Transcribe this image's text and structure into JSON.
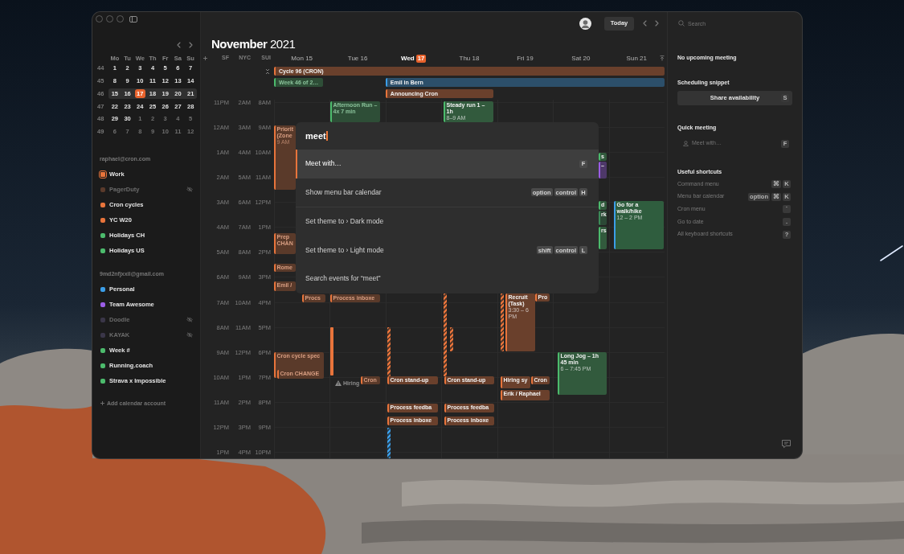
{
  "sidebar": {
    "mini_calendar": {
      "weekdays": [
        "Mo",
        "Tu",
        "We",
        "Th",
        "Fr",
        "Sa",
        "Su"
      ],
      "weeks": [
        {
          "number": "44",
          "highlighted": false,
          "days": [
            {
              "label": "1",
              "other_month": false,
              "selected": false
            },
            {
              "label": "2",
              "other_month": false,
              "selected": false
            },
            {
              "label": "3",
              "other_month": false,
              "selected": false
            },
            {
              "label": "4",
              "other_month": false,
              "selected": false
            },
            {
              "label": "5",
              "other_month": false,
              "selected": false
            },
            {
              "label": "6",
              "other_month": false,
              "selected": false
            },
            {
              "label": "7",
              "other_month": false,
              "selected": false
            }
          ]
        },
        {
          "number": "45",
          "highlighted": false,
          "days": [
            {
              "label": "8",
              "other_month": false,
              "selected": false
            },
            {
              "label": "9",
              "other_month": false,
              "selected": false
            },
            {
              "label": "10",
              "other_month": false,
              "selected": false
            },
            {
              "label": "11",
              "other_month": false,
              "selected": false
            },
            {
              "label": "12",
              "other_month": false,
              "selected": false
            },
            {
              "label": "13",
              "other_month": false,
              "selected": false
            },
            {
              "label": "14",
              "other_month": false,
              "selected": false
            }
          ]
        },
        {
          "number": "46",
          "highlighted": true,
          "days": [
            {
              "label": "15",
              "other_month": false,
              "selected": false
            },
            {
              "label": "16",
              "other_month": false,
              "selected": false
            },
            {
              "label": "17",
              "other_month": false,
              "selected": true
            },
            {
              "label": "18",
              "other_month": false,
              "selected": false
            },
            {
              "label": "19",
              "other_month": false,
              "selected": false
            },
            {
              "label": "20",
              "other_month": false,
              "selected": false
            },
            {
              "label": "21",
              "other_month": false,
              "selected": false
            }
          ]
        },
        {
          "number": "47",
          "highlighted": false,
          "days": [
            {
              "label": "22",
              "other_month": false,
              "selected": false
            },
            {
              "label": "23",
              "other_month": false,
              "selected": false
            },
            {
              "label": "24",
              "other_month": false,
              "selected": false
            },
            {
              "label": "25",
              "other_month": false,
              "selected": false
            },
            {
              "label": "26",
              "other_month": false,
              "selected": false
            },
            {
              "label": "27",
              "other_month": false,
              "selected": false
            },
            {
              "label": "28",
              "other_month": false,
              "selected": false
            }
          ]
        },
        {
          "number": "48",
          "highlighted": false,
          "days": [
            {
              "label": "29",
              "other_month": false,
              "selected": false
            },
            {
              "label": "30",
              "other_month": false,
              "selected": false
            },
            {
              "label": "1",
              "other_month": true,
              "selected": false
            },
            {
              "label": "2",
              "other_month": true,
              "selected": false
            },
            {
              "label": "3",
              "other_month": true,
              "selected": false
            },
            {
              "label": "4",
              "other_month": true,
              "selected": false
            },
            {
              "label": "5",
              "other_month": true,
              "selected": false
            }
          ]
        },
        {
          "number": "49",
          "highlighted": false,
          "days": [
            {
              "label": "6",
              "other_month": true,
              "selected": false
            },
            {
              "label": "7",
              "other_month": true,
              "selected": false
            },
            {
              "label": "8",
              "other_month": true,
              "selected": false
            },
            {
              "label": "9",
              "other_month": true,
              "selected": false
            },
            {
              "label": "10",
              "other_month": true,
              "selected": false
            },
            {
              "label": "11",
              "other_month": true,
              "selected": false
            },
            {
              "label": "12",
              "other_month": true,
              "selected": false
            }
          ]
        }
      ]
    },
    "accounts": [
      {
        "email": "raphael@cron.com",
        "calendars": [
          {
            "name": "Work",
            "color": "#e8743b",
            "hidden": false,
            "selected": true
          },
          {
            "name": "PagerDuty",
            "color": "#5a3a2b",
            "hidden": true,
            "selected": false
          },
          {
            "name": "Cron cycles",
            "color": "#e8743b",
            "hidden": false,
            "selected": false
          },
          {
            "name": "YC W20",
            "color": "#e8743b",
            "hidden": false,
            "selected": false
          },
          {
            "name": "Holidays CH",
            "color": "#4cbb6c",
            "hidden": false,
            "selected": false
          },
          {
            "name": "Holidays US",
            "color": "#4cbb6c",
            "hidden": false,
            "selected": false
          }
        ]
      },
      {
        "email": "9md2nfjxxil@gmail.com",
        "calendars": [
          {
            "name": "Personal",
            "color": "#3b9ee8",
            "hidden": false,
            "selected": false
          },
          {
            "name": "Team Awesome",
            "color": "#9b5de5",
            "hidden": false,
            "selected": false
          },
          {
            "name": "Doodle",
            "color": "#3a3648",
            "hidden": true,
            "selected": false
          },
          {
            "name": "KAYAK",
            "color": "#3a3648",
            "hidden": true,
            "selected": false
          },
          {
            "name": "Week #",
            "color": "#4cbb6c",
            "hidden": false,
            "selected": false
          },
          {
            "name": "Running.coach",
            "color": "#4cbb6c",
            "hidden": false,
            "selected": false
          },
          {
            "name": "Strava x Impossible",
            "color": "#4cbb6c",
            "hidden": false,
            "selected": false
          }
        ]
      }
    ],
    "add_account": "Add calendar account"
  },
  "calendar": {
    "title": "**November** 2021",
    "today_button": "Today",
    "timezones": [
      "SF",
      "NYC",
      "SUI"
    ],
    "hours": [
      [
        "11PM",
        "2AM",
        "8AM"
      ],
      [
        "12AM",
        "3AM",
        "9AM"
      ],
      [
        "1AM",
        "4AM",
        "10AM"
      ],
      [
        "2AM",
        "5AM",
        "11AM"
      ],
      [
        "3AM",
        "6AM",
        "12PM"
      ],
      [
        "4AM",
        "7AM",
        "1PM"
      ],
      [
        "5AM",
        "8AM",
        "2PM"
      ],
      [
        "6AM",
        "9AM",
        "3PM"
      ],
      [
        "7AM",
        "10AM",
        "4PM"
      ],
      [
        "8AM",
        "11AM",
        "5PM"
      ],
      [
        "9AM",
        "12PM",
        "6PM"
      ],
      [
        "10AM",
        "1PM",
        "7PM"
      ],
      [
        "11AM",
        "2PM",
        "8PM"
      ],
      [
        "12PM",
        "3PM",
        "9PM"
      ],
      [
        "1PM",
        "4PM",
        "10PM"
      ]
    ],
    "all_day": [
      {
        "title": "Cycle 96 (CRON)",
        "color": "#e8743b",
        "past": false
      },
      {
        "title": "Week 46 of 2…",
        "color": "#4cbb6c",
        "past": true
      },
      {
        "title": "Emil in Bern",
        "color": "#3b9ee8",
        "past": false
      },
      {
        "title": "Announcing Cron",
        "color": "#e8743b",
        "past": false
      }
    ],
    "days": [
      {
        "weekday": "Mon",
        "date": "15",
        "today": false,
        "events": [
          {
            "kind": "event",
            "title": "Priorit (Zone",
            "time": "9 AM",
            "color": "#e8743b",
            "past": true
          },
          {
            "kind": "event",
            "title": "Prep CHAN",
            "color": "#e8743b",
            "past": true
          },
          {
            "kind": "event",
            "title": "Rome",
            "color": "#e8743b",
            "past": true
          },
          {
            "kind": "event",
            "title": "Emil /",
            "color": "#e8743b",
            "past": true
          },
          {
            "kind": "event",
            "title": "Procs",
            "color": "#e8743b",
            "past": true
          },
          {
            "kind": "event",
            "title": "Cron cycle spec",
            "color": "#e8743b",
            "past": true
          },
          {
            "kind": "event",
            "title": "Cron CHANGE",
            "color": "#e8743b",
            "past": true
          }
        ]
      },
      {
        "weekday": "Tue",
        "date": "16",
        "today": false,
        "events": [
          {
            "kind": "event",
            "title": "Afternoon Run – 4x 7 min",
            "color": "#4cbb6c",
            "past": true
          },
          {
            "kind": "event",
            "title": "Process inboxe",
            "color": "#e8743b",
            "past": true
          },
          {
            "kind": "bar",
            "color": "#e8743b",
            "past": true
          },
          {
            "kind": "alert",
            "title": "Hiring",
            "color": "#8a8a8a",
            "past": true
          },
          {
            "kind": "event",
            "title": "Cron",
            "color": "#e8743b",
            "past": true
          }
        ]
      },
      {
        "weekday": "Wed",
        "date": "17",
        "today": true,
        "events": [
          {
            "kind": "bar",
            "color": "#e8743b",
            "past": false
          },
          {
            "kind": "event",
            "title": "Cron stand-up",
            "color": "#e8743b",
            "past": false
          },
          {
            "kind": "event",
            "title": "Process feedba",
            "color": "#e8743b",
            "past": false
          },
          {
            "kind": "event",
            "title": "Process inboxe",
            "color": "#e8743b",
            "past": false
          },
          {
            "kind": "bar",
            "color": "#3b9ee8",
            "past": false
          }
        ]
      },
      {
        "weekday": "Thu",
        "date": "18",
        "today": false,
        "events": [
          {
            "kind": "event",
            "title": "Steady run 1 – 1h",
            "time": "8–9 AM",
            "color": "#4cbb6c",
            "past": false
          },
          {
            "kind": "bar",
            "color": "#e8743b",
            "past": false
          },
          {
            "kind": "bar",
            "color": "#e8743b",
            "past": false
          },
          {
            "kind": "event",
            "title": "Cron stand-up",
            "color": "#e8743b",
            "past": false
          },
          {
            "kind": "event",
            "title": "Process feedba",
            "color": "#e8743b",
            "past": false
          },
          {
            "kind": "event",
            "title": "Process inboxe",
            "color": "#e8743b",
            "past": false
          }
        ]
      },
      {
        "weekday": "Fri",
        "date": "19",
        "today": false,
        "events": [
          {
            "kind": "bar",
            "color": "#e8743b",
            "past": false
          },
          {
            "kind": "event",
            "title": "Recruit (Task)",
            "time": "3:30 – 6 PM",
            "color": "#e8743b",
            "past": false
          },
          {
            "kind": "event",
            "title": "Pro",
            "color": "#e8743b",
            "past": false
          },
          {
            "kind": "event",
            "title": "Hiring sy",
            "color": "#e8743b",
            "past": false
          },
          {
            "kind": "event",
            "title": "Cron",
            "color": "#e8743b",
            "past": false
          },
          {
            "kind": "event",
            "title": "Erik / Raphael",
            "color": "#e8743b",
            "past": false
          }
        ]
      },
      {
        "weekday": "Sat",
        "date": "20",
        "today": false,
        "events": [
          {
            "kind": "fragment",
            "title": "s",
            "color": "#4cbb6c",
            "past": false
          },
          {
            "kind": "fragment",
            "title": "–",
            "color": "#9b5de5",
            "past": false
          },
          {
            "kind": "fragment",
            "title": "d",
            "color": "#4cbb6c",
            "past": false
          },
          {
            "kind": "fragment",
            "title": "rk",
            "color": "#3c8a58",
            "past": false
          },
          {
            "kind": "fragment",
            "title": "rs",
            "color": "#4cbb6c",
            "past": false
          },
          {
            "kind": "event",
            "title": "Long Jog – 1h 45 min",
            "time": "6 – 7:45 PM",
            "color": "#4cbb6c",
            "past": false
          }
        ]
      },
      {
        "weekday": "Sun",
        "date": "21",
        "today": false,
        "events": [
          {
            "kind": "event",
            "title": "Go for a walk/hike",
            "time": "12 – 2 PM",
            "color": "#3b9ee8",
            "fill": {
              "color": "#2f5d3e"
            },
            "past": false
          }
        ]
      }
    ]
  },
  "command_menu": {
    "query": "meet",
    "sections": [
      {
        "items": [
          {
            "label": "Meet with…",
            "selected": true,
            "keys": [
              "F"
            ]
          },
          {
            "label": "Show menu bar calendar",
            "selected": false,
            "keys": [
              "option",
              "control",
              "H"
            ]
          }
        ]
      },
      {
        "items": [
          {
            "label": "Set theme to › Dark mode",
            "selected": false
          },
          {
            "label": "Set theme to › Light mode",
            "selected": false,
            "keys": [
              "shift",
              "control",
              "L"
            ]
          },
          {
            "label": "Search events for “meet”",
            "selected": false
          }
        ]
      }
    ]
  },
  "right_panel": {
    "search_placeholder": "Search",
    "status": "No upcoming meeting",
    "scheduling": {
      "heading": "Scheduling snippet",
      "button": "Share availability",
      "key": "S"
    },
    "quick_meeting": {
      "heading": "Quick meeting",
      "placeholder": "Meet with…",
      "key": "F"
    },
    "shortcuts": {
      "heading": "Useful shortcuts",
      "items": [
        {
          "label": "Command menu",
          "keys": [
            "⌘",
            "K"
          ]
        },
        {
          "label": "Menu bar calendar",
          "keys": [
            "option",
            "⌘",
            "K"
          ]
        },
        {
          "label": "Cron menu",
          "keys": [
            "`"
          ]
        },
        {
          "label": "Go to date",
          "keys": [
            "."
          ]
        },
        {
          "label": "All keyboard shortcuts",
          "keys": [
            "?"
          ]
        }
      ]
    }
  }
}
